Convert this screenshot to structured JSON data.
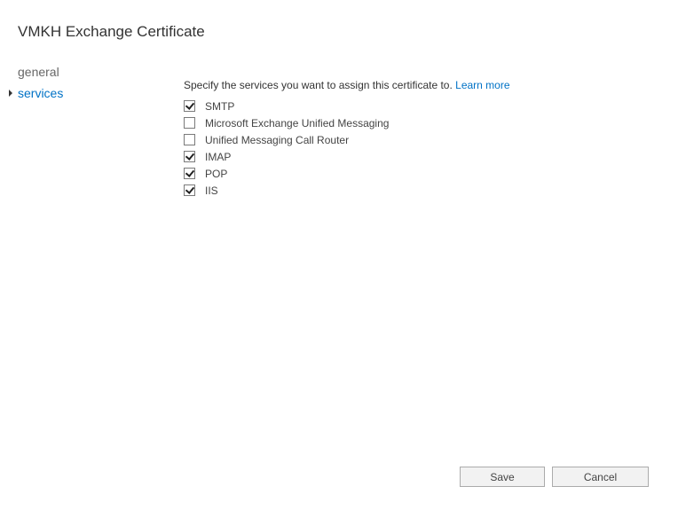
{
  "window": {
    "title": "VMKH Exchange Certificate"
  },
  "nav": {
    "items": [
      {
        "label": "general",
        "active": false
      },
      {
        "label": "services",
        "active": true
      }
    ]
  },
  "services": {
    "intro": "Specify the services you want to assign this certificate to.",
    "learn_more": "Learn more",
    "options": [
      {
        "label": "SMTP",
        "checked": true
      },
      {
        "label": "Microsoft Exchange Unified Messaging",
        "checked": false
      },
      {
        "label": "Unified Messaging Call Router",
        "checked": false
      },
      {
        "label": "IMAP",
        "checked": true
      },
      {
        "label": "POP",
        "checked": true
      },
      {
        "label": "IIS",
        "checked": true
      }
    ]
  },
  "buttons": {
    "save": "Save",
    "cancel": "Cancel"
  },
  "colors": {
    "accent": "#0072c6",
    "text": "#333333"
  }
}
